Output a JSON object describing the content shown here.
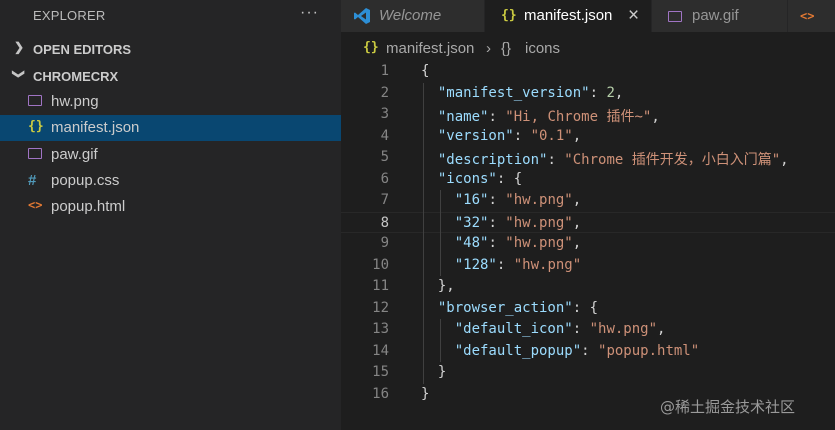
{
  "sidebar": {
    "title": "EXPLORER",
    "more_icon": "···",
    "open_editors": "OPEN EDITORS",
    "folder": "CHROMECRX",
    "files": [
      {
        "name": "hw.png",
        "icon": "image-icon"
      },
      {
        "name": "manifest.json",
        "icon": "json-icon"
      },
      {
        "name": "paw.gif",
        "icon": "image-icon"
      },
      {
        "name": "popup.css",
        "icon": "css-icon"
      },
      {
        "name": "popup.html",
        "icon": "html-icon"
      }
    ]
  },
  "tabs": [
    {
      "label": "Welcome",
      "icon": "vscode-icon"
    },
    {
      "label": "manifest.json",
      "icon": "json-icon",
      "close": "×"
    },
    {
      "label": "paw.gif",
      "icon": "image-icon"
    },
    {
      "label": "<>",
      "icon": "html-icon"
    }
  ],
  "breadcrumb": {
    "file_icon": "{}",
    "file": "manifest.json",
    "sep": "›",
    "symbol_icon": "{}",
    "symbol": "icons"
  },
  "editor": {
    "current_line": 8,
    "lines": [
      {
        "n": "1",
        "segs": [
          [
            "p",
            "{"
          ]
        ]
      },
      {
        "n": "2",
        "segs": [
          [
            "p",
            "  "
          ],
          [
            "k",
            "\"manifest_version\""
          ],
          [
            "p",
            ": "
          ],
          [
            "n",
            "2"
          ],
          [
            "p",
            ","
          ]
        ]
      },
      {
        "n": "3",
        "segs": [
          [
            "p",
            "  "
          ],
          [
            "k",
            "\"name\""
          ],
          [
            "p",
            ": "
          ],
          [
            "s",
            "\"Hi, Chrome 插件~\""
          ],
          [
            "p",
            ","
          ]
        ]
      },
      {
        "n": "4",
        "segs": [
          [
            "p",
            "  "
          ],
          [
            "k",
            "\"version\""
          ],
          [
            "p",
            ": "
          ],
          [
            "s",
            "\"0.1\""
          ],
          [
            "p",
            ","
          ]
        ]
      },
      {
        "n": "5",
        "segs": [
          [
            "p",
            "  "
          ],
          [
            "k",
            "\"description\""
          ],
          [
            "p",
            ": "
          ],
          [
            "s",
            "\"Chrome 插件开发，小白入门篇\""
          ],
          [
            "p",
            ","
          ]
        ]
      },
      {
        "n": "6",
        "segs": [
          [
            "p",
            "  "
          ],
          [
            "k",
            "\"icons\""
          ],
          [
            "p",
            ": {"
          ]
        ]
      },
      {
        "n": "7",
        "segs": [
          [
            "p",
            "    "
          ],
          [
            "k",
            "\"16\""
          ],
          [
            "p",
            ": "
          ],
          [
            "s",
            "\"hw.png\""
          ],
          [
            "p",
            ","
          ]
        ]
      },
      {
        "n": "8",
        "segs": [
          [
            "p",
            "    "
          ],
          [
            "k",
            "\"32\""
          ],
          [
            "p",
            ": "
          ],
          [
            "s",
            "\"hw.png\""
          ],
          [
            "p",
            ","
          ]
        ]
      },
      {
        "n": "9",
        "segs": [
          [
            "p",
            "    "
          ],
          [
            "k",
            "\"48\""
          ],
          [
            "p",
            ": "
          ],
          [
            "s",
            "\"hw.png\""
          ],
          [
            "p",
            ","
          ]
        ]
      },
      {
        "n": "10",
        "segs": [
          [
            "p",
            "    "
          ],
          [
            "k",
            "\"128\""
          ],
          [
            "p",
            ": "
          ],
          [
            "s",
            "\"hw.png\""
          ]
        ]
      },
      {
        "n": "11",
        "segs": [
          [
            "p",
            "  },"
          ]
        ]
      },
      {
        "n": "12",
        "segs": [
          [
            "p",
            "  "
          ],
          [
            "k",
            "\"browser_action\""
          ],
          [
            "p",
            ": {"
          ]
        ]
      },
      {
        "n": "13",
        "segs": [
          [
            "p",
            "    "
          ],
          [
            "k",
            "\"default_icon\""
          ],
          [
            "p",
            ": "
          ],
          [
            "s",
            "\"hw.png\""
          ],
          [
            "p",
            ","
          ]
        ]
      },
      {
        "n": "14",
        "segs": [
          [
            "p",
            "    "
          ],
          [
            "k",
            "\"default_popup\""
          ],
          [
            "p",
            ": "
          ],
          [
            "s",
            "\"popup.html\""
          ]
        ]
      },
      {
        "n": "15",
        "segs": [
          [
            "p",
            "  }"
          ]
        ]
      },
      {
        "n": "16",
        "segs": [
          [
            "p",
            "}"
          ]
        ]
      }
    ]
  },
  "watermark": "@稀土掘金技术社区",
  "colors": {
    "key": "#9cdcfe",
    "string": "#ce9178",
    "number": "#b5cea8",
    "selection": "#094771"
  }
}
